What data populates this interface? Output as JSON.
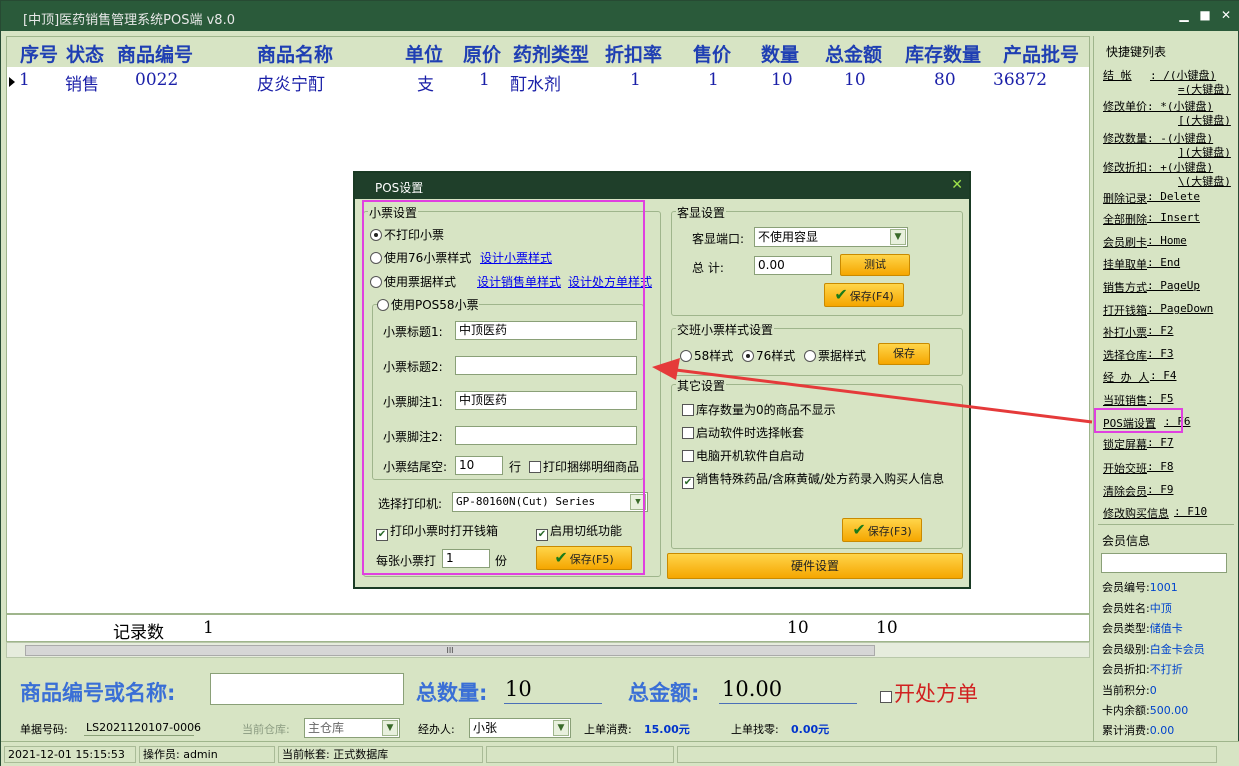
{
  "window": {
    "title": "[中顶]医药销售管理系统POS端 v8.0"
  },
  "grid": {
    "headers": [
      "序号",
      "状态",
      "商品编号",
      "商品名称",
      "单位",
      "原价",
      "药剂类型",
      "折扣率",
      "售价",
      "数量",
      "总金额",
      "库存数量",
      "产品批号"
    ],
    "rows": [
      {
        "seq": "1",
        "status": "销售",
        "code": "0022",
        "name": "皮炎宁酊",
        "unit": "支",
        "price": "1",
        "type": "酊水剂",
        "discount": "1",
        "sale": "1",
        "qty": "10",
        "total": "10",
        "stock": "80",
        "batch": "36872"
      }
    ],
    "footer": {
      "label": "记录数",
      "count": "1",
      "qty_sum": "10",
      "total_sum": "10"
    },
    "scroll_grip": "III"
  },
  "sidebar": {
    "title": "快捷键列表",
    "shortcuts": [
      {
        "name": "结    帐",
        "key": ": /(小键盘)"
      },
      {
        "name": "",
        "key": "=(大键盘)"
      },
      {
        "name": "修改单价",
        "key": ": *(小键盘)"
      },
      {
        "name": "",
        "key": "[(大键盘)"
      },
      {
        "name": "修改数量",
        "key": ": -(小键盘)"
      },
      {
        "name": "",
        "key": "](大键盘)"
      },
      {
        "name": "修改折扣",
        "key": ": +(小键盘)"
      },
      {
        "name": "",
        "key": "\\(大键盘)"
      },
      {
        "name": "删除记录",
        "key": ": Delete"
      },
      {
        "name": "全部删除",
        "key": ": Insert"
      },
      {
        "name": "会员刷卡",
        "key": ": Home"
      },
      {
        "name": "挂单取单",
        "key": ": End"
      },
      {
        "name": "销售方式",
        "key": ": PageUp"
      },
      {
        "name": "打开钱箱",
        "key": ": PageDown"
      },
      {
        "name": "补打小票",
        "key": ": F2"
      },
      {
        "name": "选择仓库",
        "key": ": F3"
      },
      {
        "name": "经 办 人",
        "key": ": F4"
      },
      {
        "name": "当班销售",
        "key": ": F5"
      },
      {
        "name": "POS端设置",
        "key": ": F6"
      },
      {
        "name": "锁定屏幕",
        "key": ": F7"
      },
      {
        "name": "开始交班",
        "key": ": F8"
      },
      {
        "name": "清除会员",
        "key": ": F9"
      },
      {
        "name": "修改购买信息",
        "key": ": F10"
      }
    ],
    "member": {
      "title": "会员信息",
      "fields": [
        {
          "label": "会员编号:",
          "value": "1001"
        },
        {
          "label": "会员姓名:",
          "value": "中顶"
        },
        {
          "label": "会员类型:",
          "value": "储值卡"
        },
        {
          "label": "会员级别:",
          "value": "白金卡会员"
        },
        {
          "label": "会员折扣:",
          "value": "不打折"
        },
        {
          "label": "当前积分:",
          "value": "0"
        },
        {
          "label": "卡内余额:",
          "value": "500.00"
        },
        {
          "label": "累计消费:",
          "value": "0.00"
        }
      ]
    }
  },
  "bottom": {
    "search_label": "商品编号或名称:",
    "search_value": "",
    "total_qty_label": "总数量:",
    "total_qty": "10",
    "total_amount_label": "总金额:",
    "total_amount": "10.00",
    "prescription_label": "开处方单",
    "order_no_label": "单据号码:",
    "order_no": "LS2021120107-0006",
    "warehouse_label": "当前仓库:",
    "warehouse": "主仓库",
    "handler_label": "经办人:",
    "handler": "小张",
    "last_spend_label": "上单消费:",
    "last_spend": "15.00元",
    "last_change_label": "上单找零:",
    "last_change": "0.00元"
  },
  "statusbar": {
    "datetime": "2021-12-01 15:15:53",
    "operator": "操作员: admin",
    "account": "当前帐套: 正式数据库"
  },
  "dialog": {
    "title": "POS设置",
    "receipt": {
      "group": "小票设置",
      "opt_none": "不打印小票",
      "opt_76": "使用76小票样式",
      "link_76": "设计小票样式",
      "opt_bill": "使用票据样式",
      "link_sales": "设计销售单样式",
      "link_rx": "设计处方单样式",
      "opt_58": "使用POS58小票",
      "title1_label": "小票标题1:",
      "title1": "中顶医药",
      "title2_label": "小票标题2:",
      "title2": "",
      "foot1_label": "小票脚注1:",
      "foot1": "中顶医药",
      "foot2_label": "小票脚注2:",
      "foot2": "",
      "tail_label": "小票结尾空:",
      "tail": "10",
      "tail_unit": "行",
      "bundle_label": "打印捆绑明细商品",
      "printer_label": "选择打印机:",
      "printer": "GP-80160N(Cut) Series",
      "open_drawer_label": "打印小票时打开钱箱",
      "cut_label": "启用切纸功能",
      "copies_label": "每张小票打",
      "copies": "1",
      "copies_unit": "份",
      "save": "保存(F5)"
    },
    "display": {
      "group": "客显设置",
      "port_label": "客显端口:",
      "port": "不使用容显",
      "total_label": "总    计:",
      "total": "0.00",
      "test": "测试",
      "save": "保存(F4)"
    },
    "shift": {
      "group": "交班小票样式设置",
      "opt58": "58样式",
      "opt76": "76样式",
      "optbill": "票据样式",
      "save": "保存"
    },
    "other": {
      "group": "其它设置",
      "c1": "库存数量为0的商品不显示",
      "c2": "启动软件时选择帐套",
      "c3": "电脑开机软件自启动",
      "c4": "销售特殊药品/含麻黄碱/处方药录入购买人信息",
      "save": "保存(F3)"
    },
    "hardware": "硬件设置"
  }
}
